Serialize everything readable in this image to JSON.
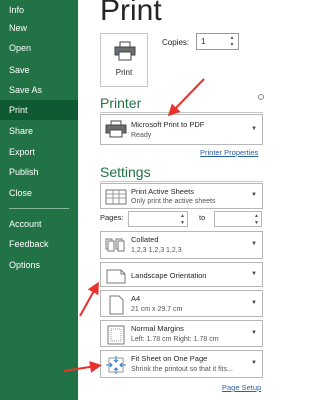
{
  "sidebar": {
    "items": [
      {
        "label": "Info"
      },
      {
        "label": "New"
      },
      {
        "label": "Open"
      },
      {
        "label": "Save"
      },
      {
        "label": "Save As"
      },
      {
        "label": "Print"
      },
      {
        "label": "Share"
      },
      {
        "label": "Export"
      },
      {
        "label": "Publish"
      },
      {
        "label": "Close"
      },
      {
        "label": "Account"
      },
      {
        "label": "Feedback"
      },
      {
        "label": "Options"
      }
    ]
  },
  "print": {
    "title": "Print",
    "button_label": "Print",
    "copies_label": "Copies:",
    "copies_value": "1"
  },
  "printer": {
    "heading": "Printer",
    "name": "Microsoft Print to PDF",
    "status": "Ready",
    "properties_link": "Printer Properties"
  },
  "settings": {
    "heading": "Settings",
    "scope": {
      "title": "Print Active Sheets",
      "subtitle": "Only print the active sheets"
    },
    "pages_label": "Pages:",
    "to_label": "to",
    "collation": {
      "title": "Collated",
      "subtitle": "1,2,3    1,2,3    1,2,3"
    },
    "orientation": {
      "title": "Landscape Orientation"
    },
    "paper": {
      "title": "A4",
      "subtitle": "21 cm x 29.7 cm"
    },
    "margins": {
      "title": "Normal Margins",
      "subtitle": "Left:  1.78 cm    Right:  1.78 cm"
    },
    "scaling": {
      "title": "Fit Sheet on One Page",
      "subtitle": "Shrink the printout so that it fits..."
    },
    "page_setup_link": "Page Setup"
  },
  "colors": {
    "sidebar_bg": "#217346",
    "sidebar_active": "#0f5a32",
    "accent_green": "#217346",
    "annotation_red": "#e8322d",
    "link_blue": "#2a5fa8"
  }
}
